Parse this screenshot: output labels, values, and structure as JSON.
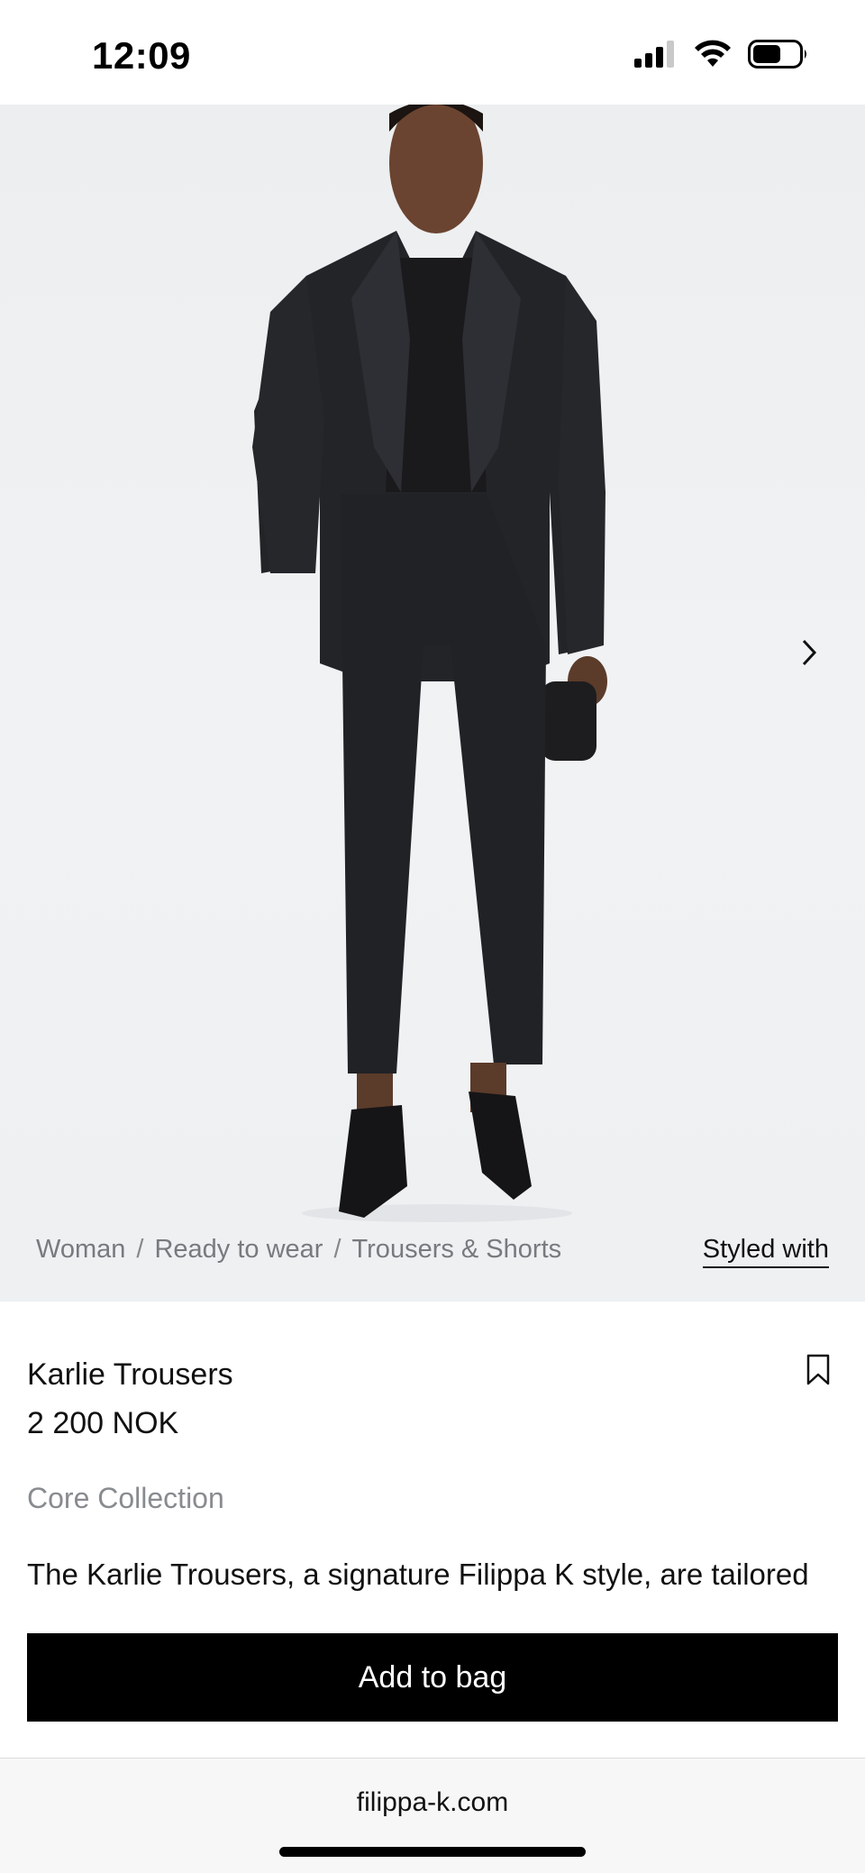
{
  "status_bar": {
    "time": "12:09",
    "icons": [
      "cellular-signal-icon",
      "wifi-icon",
      "battery-icon"
    ]
  },
  "hero": {
    "image_description_icon": "product-model-image",
    "next_icon": "chevron-right-icon"
  },
  "breadcrumb": {
    "items": [
      "Woman",
      "Ready to wear",
      "Trousers & Shorts"
    ],
    "separator": "/"
  },
  "styled_with_label": "Styled with",
  "product": {
    "title": "Karlie Trousers",
    "price": "2 200 NOK",
    "collection": "Core Collection",
    "description": "The Karlie Trousers, a signature Filippa K style, are tailored",
    "bookmark_icon": "bookmark-icon"
  },
  "add_to_bag_label": "Add to bag",
  "browser": {
    "url": "filippa-k.com"
  },
  "colors": {
    "primary_button": "#000000",
    "breadcrumb_text": "#777a7e",
    "muted_text": "#888b8f"
  }
}
